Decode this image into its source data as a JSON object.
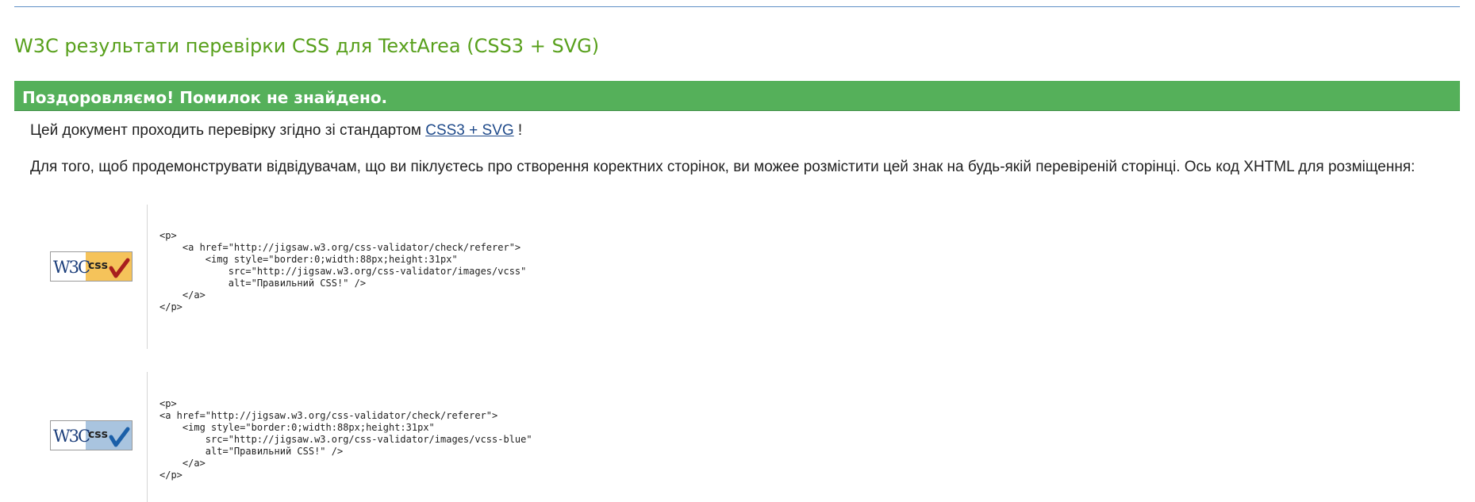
{
  "page": {
    "title": "W3C результати перевірки CSS для TextArea (CSS3 + SVG)"
  },
  "banner": {
    "text": "Поздоровляємо! Помилок не знайдено."
  },
  "paragraph1": {
    "prefix": "Цей документ проходить перевірку згідно зі стандартом ",
    "link": "CSS3 + SVG",
    "suffix": " !"
  },
  "paragraph2": {
    "text": "Для того, щоб продемонструвати відвідувачам, що ви піклуєтесь про створення коректних сторінок, ви можее розмістити цей знак на будь-якій перевіреній сторінці. Ось код XHTML для розміщення:"
  },
  "badges": [
    {
      "logo_w3c": "W3C",
      "logo_css": "css",
      "accent": "#f5c35a",
      "check": "#a81e1e",
      "icon": "css-valid-badge-gold",
      "code": "<p>\n    <a href=\"http://jigsaw.w3.org/css-validator/check/referer\">\n        <img style=\"border:0;width:88px;height:31px\"\n            src=\"http://jigsaw.w3.org/css-validator/images/vcss\"\n            alt=\"Правильний CSS!\" />\n    </a>\n</p>"
    },
    {
      "logo_w3c": "W3C",
      "logo_css": "css",
      "accent": "#a9c4df",
      "check": "#1b5fa8",
      "icon": "css-valid-badge-blue",
      "code": "<p>\n<a href=\"http://jigsaw.w3.org/css-validator/check/referer\">\n    <img style=\"border:0;width:88px;height:31px\"\n        src=\"http://jigsaw.w3.org/css-validator/images/vcss-blue\"\n        alt=\"Правильний CSS!\" />\n    </a>\n</p>"
    }
  ],
  "colors": {
    "title_green": "#58a01c",
    "banner_green": "#55b05a",
    "link_blue": "#1f4a8a"
  }
}
